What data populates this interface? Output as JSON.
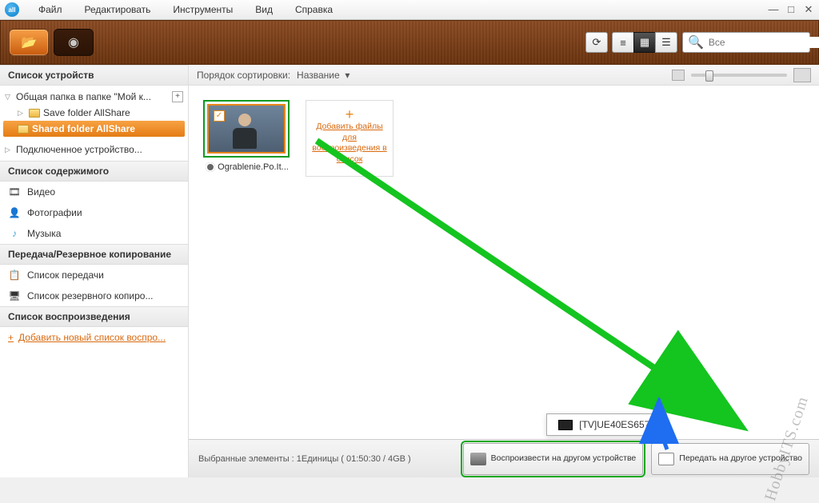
{
  "menus": {
    "file": "Файл",
    "edit": "Редактировать",
    "tools": "Инструменты",
    "view": "Вид",
    "help": "Справка"
  },
  "search": {
    "placeholder": "Все"
  },
  "sidebar": {
    "devices_header": "Список устройств",
    "root": "Общая папка в папке \"Мой к...",
    "child1": "Save folder AllShare",
    "child2": "Shared folder AllShare",
    "connected": "Подключенное устройство...",
    "content_header": "Список содержимого",
    "video": "Видео",
    "photo": "Фотографии",
    "music": "Музыка",
    "transfer_header": "Передача/Резервное копирование",
    "transfer_list": "Список передачи",
    "backup_list": "Список резервного копиро...",
    "playlist_header": "Список воспроизведения",
    "add_playlist": "Добавить новый список воспро..."
  },
  "sort": {
    "label": "Порядок сортировки:",
    "value": "Название"
  },
  "item": {
    "name": "Ograblenie.Po.It..."
  },
  "add_card": "Добавить файлы для воспроизведения в список",
  "status": "Выбранные элементы : 1Единицы ( 01:50:30 / 4GB )",
  "device": "[TV]UE40ES6570",
  "btn_play": "Воспроизвести на другом устройстве",
  "btn_send": "Передать на другое устройство",
  "watermark": "HobbyITS.com"
}
